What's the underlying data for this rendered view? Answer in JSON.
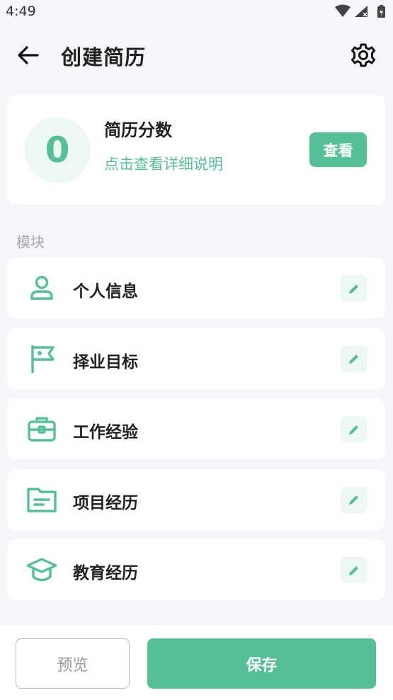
{
  "status_bar": {
    "time": "4:49"
  },
  "header": {
    "title": "创建简历",
    "back_icon": "arrow-left-icon",
    "settings_icon": "gear-icon"
  },
  "score_card": {
    "score": "0",
    "title": "简历分数",
    "detail_link": "点击查看详细说明",
    "view_button": "查看"
  },
  "modules": {
    "section_label": "模块",
    "items": [
      {
        "label": "个人信息",
        "icon": "person-icon"
      },
      {
        "label": "择业目标",
        "icon": "flag-icon"
      },
      {
        "label": "工作经验",
        "icon": "briefcase-icon"
      },
      {
        "label": "项目经历",
        "icon": "folder-icon"
      },
      {
        "label": "教育经历",
        "icon": "graduation-cap-icon"
      }
    ]
  },
  "footer": {
    "preview_button": "预览",
    "save_button": "保存"
  },
  "colors": {
    "accent": "#55c095",
    "accent_light": "#edf8f3",
    "background": "#f5f6fa"
  }
}
